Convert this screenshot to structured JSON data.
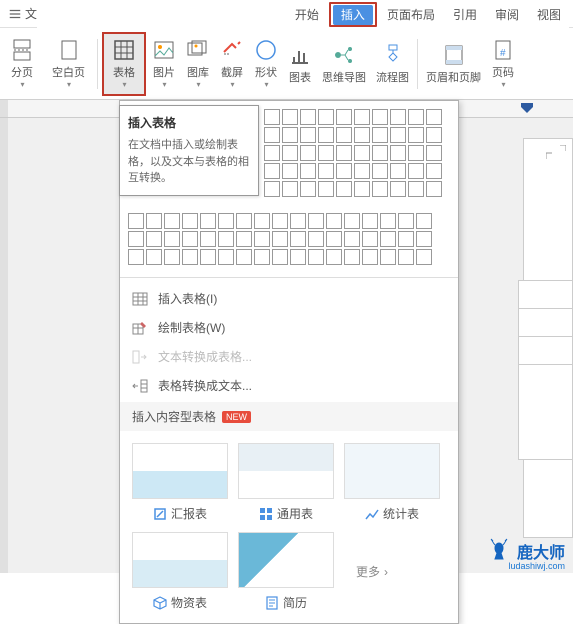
{
  "topbar": {
    "file_label": "文件",
    "menu_items": {
      "start": "开始",
      "insert": "插入",
      "layout": "页面布局",
      "reference": "引用",
      "review": "审阅",
      "view": "视图"
    }
  },
  "ribbon": {
    "page_break": "分页",
    "blank_page": "空白页",
    "table": "表格",
    "picture": "图片",
    "gallery": "图库",
    "screenshot": "截屏",
    "shape": "形状",
    "chart": "图表",
    "mindmap": "思维导图",
    "flowchart": "流程图",
    "header_footer": "页眉和页脚",
    "page_number": "页码"
  },
  "tooltip": {
    "title": "插入表格",
    "desc": "在文档中插入或绘制表格，以及文本与表格的相互转换。"
  },
  "dropdown": {
    "insert_table": "插入表格(I)",
    "draw_table": "绘制表格(W)",
    "text_to_table": "文本转换成表格...",
    "table_to_text": "表格转换成文本...",
    "content_table_header": "插入内容型表格",
    "new_badge": "NEW"
  },
  "templates": {
    "report": "汇报表",
    "general": "通用表",
    "statistics": "统计表",
    "material": "物资表",
    "resume": "简历",
    "more": "更多"
  },
  "watermark": {
    "text": "鹿大师",
    "url": "ludashiwj.com"
  }
}
